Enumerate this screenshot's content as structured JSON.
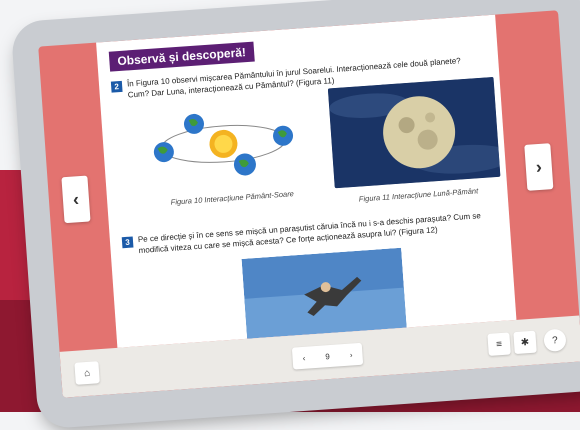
{
  "page": {
    "title": "Observă și descoperă!",
    "q2_number": "2",
    "q2_text_line1": "În Figura 10 observi mișcarea Pământului în jurul Soarelui. Interacționează cele două planete?",
    "q2_text_line2": "Cum? Dar Luna, interacționează cu Pământul? (Figura 11)",
    "fig10_caption": "Figura 10 Interacțiune Pământ-Soare",
    "fig11_caption": "Figura 11 Interacțiune Lună-Pământ",
    "q3_number": "3",
    "q3_text_line1": "Pe ce direcție și în ce sens se mișcă un parașutist căruia încă nu i s-a deschis parașuta? Cum se",
    "q3_text_line2": "modifică viteza cu care se mișcă acesta? Ce forțe acționează asupra lui? (Figura 12)"
  },
  "nav": {
    "prev_label": "‹",
    "next_label": "›"
  },
  "toolbar": {
    "home_icon": "⌂",
    "pager_prev": "‹",
    "pager_page": "9",
    "pager_next": "›",
    "menu_icon": "≡",
    "puzzle_icon": "✱",
    "help_icon": "?"
  },
  "colors": {
    "title_bg": "#5c1f74",
    "side_bg": "#e37370",
    "number_badge": "#1b5aa8"
  }
}
